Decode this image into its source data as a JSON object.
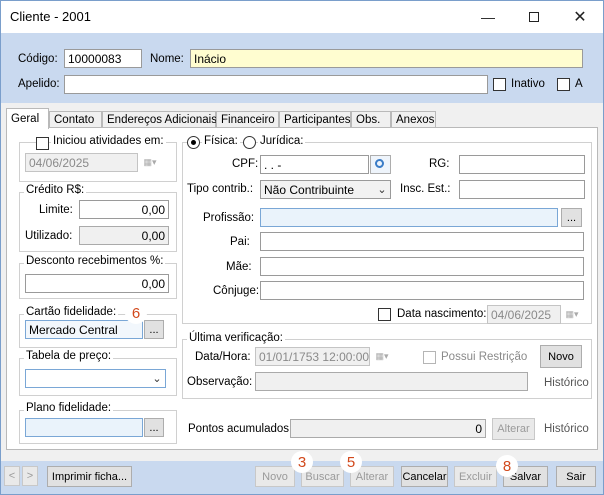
{
  "window": {
    "title": "Cliente - 2001",
    "minimize_icon": "minimize-icon",
    "maximize_icon": "maximize-icon",
    "close_icon": "close-icon"
  },
  "header": {
    "codigo_label": "Código:",
    "codigo_value": "10000083",
    "nome_label": "Nome:",
    "nome_value": "Inácio",
    "apelido_label": "Apelido:",
    "apelido_value": "",
    "inativo_label": "Inativo",
    "a_label": "A"
  },
  "tabs": [
    "Geral",
    "Contato",
    "Endereços Adicionais",
    "Financeiro",
    "Participantes",
    "Obs.",
    "Anexos"
  ],
  "left": {
    "iniciou_label": "Iniciou atividades em:",
    "iniciou_date": "04/06/2025",
    "credito_title": "Crédito R$:",
    "limite_label": "Limite:",
    "limite_value": "0,00",
    "utilizado_label": "Utilizado:",
    "utilizado_value": "0,00",
    "desconto_title": "Desconto recebimentos %:",
    "desconto_value": "0,00",
    "cartao_title": "Cartão fidelidade:",
    "cartao_value": "Mercado Central",
    "tabela_title": "Tabela de preço:",
    "tabela_value": "",
    "plano_title": "Plano fidelidade:",
    "plano_value": ""
  },
  "right": {
    "fisica_label": "Física:",
    "juridica_label": "Jurídica:",
    "cpf_label": "CPF:",
    "cpf_value": " .   .   -",
    "rg_label": "RG:",
    "rg_value": "",
    "tipo_label": "Tipo contrib.:",
    "tipo_value": "Não Contribuinte",
    "insc_label": "Insc. Est.:",
    "insc_value": "",
    "profissao_label": "Profissão:",
    "profissao_value": "",
    "pai_label": "Pai:",
    "pai_value": "",
    "mae_label": "Mãe:",
    "mae_value": "",
    "conjuge_label": "Cônjuge:",
    "conjuge_value": "",
    "nascimento_label": "Data nascimento:",
    "nascimento_value": "04/06/2025"
  },
  "verificacao": {
    "title": "Última verificação:",
    "datahora_label": "Data/Hora:",
    "datahora_value": "01/01/1753 12:00:00",
    "restricao_label": "Possui Restrição",
    "novo_label": "Novo",
    "historico_label": "Histórico",
    "observacao_label": "Observação:",
    "observacao_value": ""
  },
  "pontos": {
    "label": "Pontos acumulados:",
    "value": "0",
    "alterar_label": "Alterar",
    "historico_label": "Histórico"
  },
  "ellipsis": "...",
  "toolbar": {
    "prev": "<",
    "next": ">",
    "imprimir": "Imprimir ficha...",
    "novo": "Novo",
    "buscar": "Buscar",
    "alterar": "Alterar",
    "cancelar": "Cancelar",
    "excluir": "Excluir",
    "salvar": "Salvar",
    "sair": "Sair"
  },
  "badges": {
    "b3": "3",
    "b5": "5",
    "b6": "6",
    "b8": "8"
  },
  "colors": {
    "header_band": "#c9d9ef",
    "required_field": "#fffdd0",
    "badge_text": "#d2491c"
  }
}
